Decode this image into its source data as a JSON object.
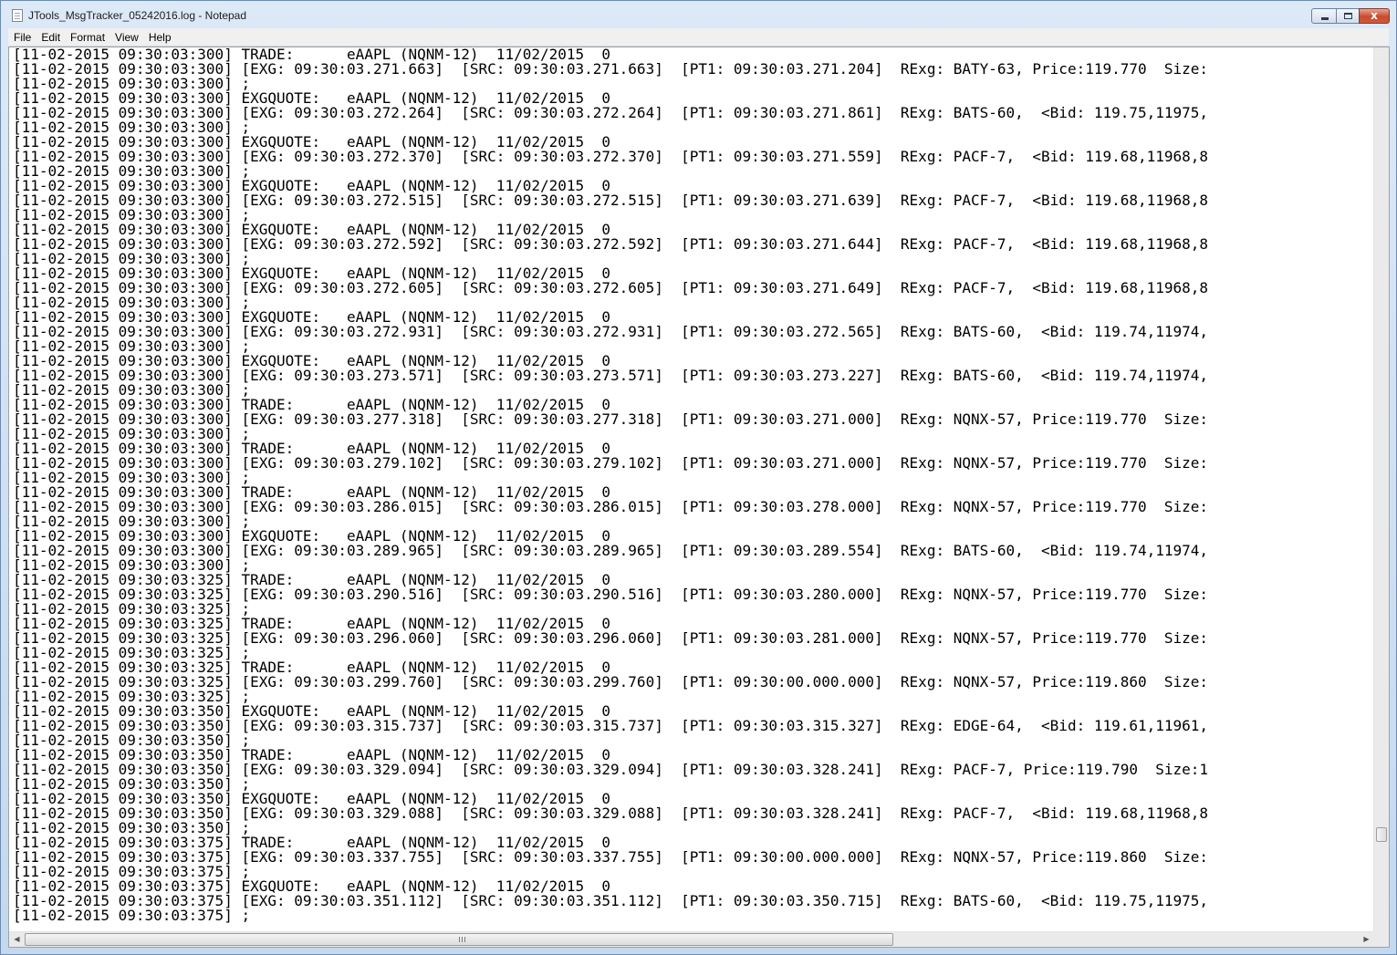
{
  "window": {
    "title": "JTools_MsgTracker_05242016.log - Notepad",
    "close_glyph": "x"
  },
  "menu": {
    "items": [
      "File",
      "Edit",
      "Format",
      "View",
      "Help"
    ]
  },
  "editor": {
    "lines": [
      "[11-02-2015 09:30:03:300] TRADE:      eAAPL (NQNM-12)  11/02/2015  0",
      "[11-02-2015 09:30:03:300] [EXG: 09:30:03.271.663]  [SRC: 09:30:03.271.663]  [PT1: 09:30:03.271.204]  RExg: BATY-63, Price:119.770  Size:",
      "[11-02-2015 09:30:03:300] ;",
      "[11-02-2015 09:30:03:300] EXGQUOTE:   eAAPL (NQNM-12)  11/02/2015  0",
      "[11-02-2015 09:30:03:300] [EXG: 09:30:03.272.264]  [SRC: 09:30:03.272.264]  [PT1: 09:30:03.271.861]  RExg: BATS-60,  <Bid: 119.75,11975,",
      "[11-02-2015 09:30:03:300] ;",
      "[11-02-2015 09:30:03:300] EXGQUOTE:   eAAPL (NQNM-12)  11/02/2015  0",
      "[11-02-2015 09:30:03:300] [EXG: 09:30:03.272.370]  [SRC: 09:30:03.272.370]  [PT1: 09:30:03.271.559]  RExg: PACF-7,  <Bid: 119.68,11968,8",
      "[11-02-2015 09:30:03:300] ;",
      "[11-02-2015 09:30:03:300] EXGQUOTE:   eAAPL (NQNM-12)  11/02/2015  0",
      "[11-02-2015 09:30:03:300] [EXG: 09:30:03.272.515]  [SRC: 09:30:03.272.515]  [PT1: 09:30:03.271.639]  RExg: PACF-7,  <Bid: 119.68,11968,8",
      "[11-02-2015 09:30:03:300] ;",
      "[11-02-2015 09:30:03:300] EXGQUOTE:   eAAPL (NQNM-12)  11/02/2015  0",
      "[11-02-2015 09:30:03:300] [EXG: 09:30:03.272.592]  [SRC: 09:30:03.272.592]  [PT1: 09:30:03.271.644]  RExg: PACF-7,  <Bid: 119.68,11968,8",
      "[11-02-2015 09:30:03:300] ;",
      "[11-02-2015 09:30:03:300] EXGQUOTE:   eAAPL (NQNM-12)  11/02/2015  0",
      "[11-02-2015 09:30:03:300] [EXG: 09:30:03.272.605]  [SRC: 09:30:03.272.605]  [PT1: 09:30:03.271.649]  RExg: PACF-7,  <Bid: 119.68,11968,8",
      "[11-02-2015 09:30:03:300] ;",
      "[11-02-2015 09:30:03:300] EXGQUOTE:   eAAPL (NQNM-12)  11/02/2015  0",
      "[11-02-2015 09:30:03:300] [EXG: 09:30:03.272.931]  [SRC: 09:30:03.272.931]  [PT1: 09:30:03.272.565]  RExg: BATS-60,  <Bid: 119.74,11974,",
      "[11-02-2015 09:30:03:300] ;",
      "[11-02-2015 09:30:03:300] EXGQUOTE:   eAAPL (NQNM-12)  11/02/2015  0",
      "[11-02-2015 09:30:03:300] [EXG: 09:30:03.273.571]  [SRC: 09:30:03.273.571]  [PT1: 09:30:03.273.227]  RExg: BATS-60,  <Bid: 119.74,11974,",
      "[11-02-2015 09:30:03:300] ;",
      "[11-02-2015 09:30:03:300] TRADE:      eAAPL (NQNM-12)  11/02/2015  0",
      "[11-02-2015 09:30:03:300] [EXG: 09:30:03.277.318]  [SRC: 09:30:03.277.318]  [PT1: 09:30:03.271.000]  RExg: NQNX-57, Price:119.770  Size:",
      "[11-02-2015 09:30:03:300] ;",
      "[11-02-2015 09:30:03:300] TRADE:      eAAPL (NQNM-12)  11/02/2015  0",
      "[11-02-2015 09:30:03:300] [EXG: 09:30:03.279.102]  [SRC: 09:30:03.279.102]  [PT1: 09:30:03.271.000]  RExg: NQNX-57, Price:119.770  Size:",
      "[11-02-2015 09:30:03:300] ;",
      "[11-02-2015 09:30:03:300] TRADE:      eAAPL (NQNM-12)  11/02/2015  0",
      "[11-02-2015 09:30:03:300] [EXG: 09:30:03.286.015]  [SRC: 09:30:03.286.015]  [PT1: 09:30:03.278.000]  RExg: NQNX-57, Price:119.770  Size:",
      "[11-02-2015 09:30:03:300] ;",
      "[11-02-2015 09:30:03:300] EXGQUOTE:   eAAPL (NQNM-12)  11/02/2015  0",
      "[11-02-2015 09:30:03:300] [EXG: 09:30:03.289.965]  [SRC: 09:30:03.289.965]  [PT1: 09:30:03.289.554]  RExg: BATS-60,  <Bid: 119.74,11974,",
      "[11-02-2015 09:30:03:300] ;",
      "[11-02-2015 09:30:03:325] TRADE:      eAAPL (NQNM-12)  11/02/2015  0",
      "[11-02-2015 09:30:03:325] [EXG: 09:30:03.290.516]  [SRC: 09:30:03.290.516]  [PT1: 09:30:03.280.000]  RExg: NQNX-57, Price:119.770  Size:",
      "[11-02-2015 09:30:03:325] ;",
      "[11-02-2015 09:30:03:325] TRADE:      eAAPL (NQNM-12)  11/02/2015  0",
      "[11-02-2015 09:30:03:325] [EXG: 09:30:03.296.060]  [SRC: 09:30:03.296.060]  [PT1: 09:30:03.281.000]  RExg: NQNX-57, Price:119.770  Size:",
      "[11-02-2015 09:30:03:325] ;",
      "[11-02-2015 09:30:03:325] TRADE:      eAAPL (NQNM-12)  11/02/2015  0",
      "[11-02-2015 09:30:03:325] [EXG: 09:30:03.299.760]  [SRC: 09:30:03.299.760]  [PT1: 09:30:00.000.000]  RExg: NQNX-57, Price:119.860  Size:",
      "[11-02-2015 09:30:03:325] ;",
      "[11-02-2015 09:30:03:350] EXGQUOTE:   eAAPL (NQNM-12)  11/02/2015  0",
      "[11-02-2015 09:30:03:350] [EXG: 09:30:03.315.737]  [SRC: 09:30:03.315.737]  [PT1: 09:30:03.315.327]  RExg: EDGE-64,  <Bid: 119.61,11961,",
      "[11-02-2015 09:30:03:350] ;",
      "[11-02-2015 09:30:03:350] TRADE:      eAAPL (NQNM-12)  11/02/2015  0",
      "[11-02-2015 09:30:03:350] [EXG: 09:30:03.329.094]  [SRC: 09:30:03.329.094]  [PT1: 09:30:03.328.241]  RExg: PACF-7, Price:119.790  Size:1",
      "[11-02-2015 09:30:03:350] ;",
      "[11-02-2015 09:30:03:350] EXGQUOTE:   eAAPL (NQNM-12)  11/02/2015  0",
      "[11-02-2015 09:30:03:350] [EXG: 09:30:03.329.088]  [SRC: 09:30:03.329.088]  [PT1: 09:30:03.328.241]  RExg: PACF-7,  <Bid: 119.68,11968,8",
      "[11-02-2015 09:30:03:350] ;",
      "[11-02-2015 09:30:03:375] TRADE:      eAAPL (NQNM-12)  11/02/2015  0",
      "[11-02-2015 09:30:03:375] [EXG: 09:30:03.337.755]  [SRC: 09:30:03.337.755]  [PT1: 09:30:00.000.000]  RExg: NQNX-57, Price:119.860  Size:",
      "[11-02-2015 09:30:03:375] ;",
      "[11-02-2015 09:30:03:375] EXGQUOTE:   eAAPL (NQNM-12)  11/02/2015  0",
      "[11-02-2015 09:30:03:375] [EXG: 09:30:03.351.112]  [SRC: 09:30:03.351.112]  [PT1: 09:30:03.350.715]  RExg: BATS-60,  <Bid: 119.75,11975,",
      "[11-02-2015 09:30:03:375] ;"
    ]
  },
  "icons": {
    "app": "notepad-icon",
    "scroll_left": "arrow-left-icon",
    "scroll_right": "arrow-right-icon"
  }
}
